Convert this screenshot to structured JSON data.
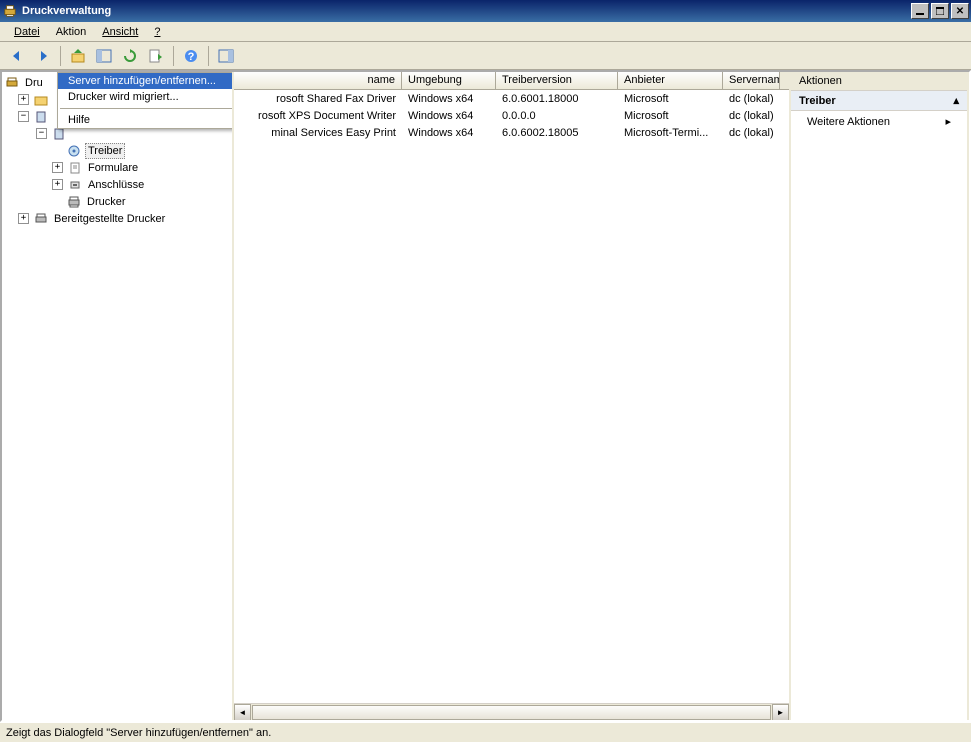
{
  "window": {
    "title": "Druckverwaltung"
  },
  "menu": {
    "file": "Datei",
    "action": "Aktion",
    "view": "Ansicht",
    "help": "?"
  },
  "tree": {
    "root_partial": "Dru",
    "treiber": "Treiber",
    "formulare": "Formulare",
    "anschluesse": "Anschlüsse",
    "drucker": "Drucker",
    "bereitgestellte": "Bereitgestellte Drucker"
  },
  "context_menu": {
    "item0": "Server hinzufügen/entfernen...",
    "item1": "Drucker wird migriert...",
    "item2": "Hilfe"
  },
  "columns": {
    "c0": "name",
    "c1": "Umgebung",
    "c2": "Treiberversion",
    "c3": "Anbieter",
    "c4": "Servernam"
  },
  "rows": [
    {
      "name_suffix": "rosoft Shared Fax Driver",
      "env": "Windows x64",
      "ver": "6.0.6001.18000",
      "vendor": "Microsoft",
      "server": "dc (lokal)"
    },
    {
      "name_suffix": "rosoft XPS Document Writer",
      "env": "Windows x64",
      "ver": "0.0.0.0",
      "vendor": "Microsoft",
      "server": "dc (lokal)"
    },
    {
      "name_suffix": "minal Services Easy Print",
      "env": "Windows x64",
      "ver": "6.0.6002.18005",
      "vendor": "Microsoft-Termi...",
      "server": "dc (lokal)"
    }
  ],
  "actions": {
    "header": "Aktionen",
    "section": "Treiber",
    "more": "Weitere Aktionen"
  },
  "status": {
    "text": "Zeigt das Dialogfeld \"Server hinzufügen/entfernen\" an."
  }
}
